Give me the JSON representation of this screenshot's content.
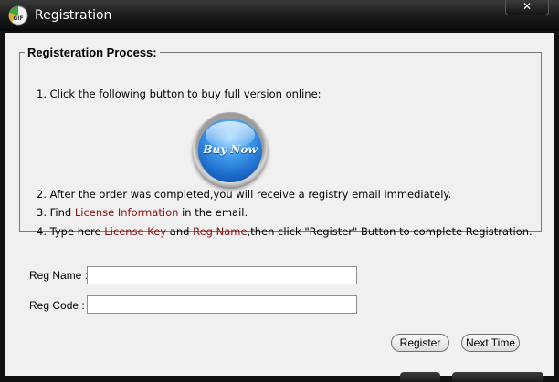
{
  "window": {
    "title": "Registration",
    "close_label": "✕",
    "icon": "gif-app-icon"
  },
  "process": {
    "legend": "Registeration Process:",
    "step1": "1. Click the following button to buy full version online:",
    "buy_now_label": "Buy Now",
    "step2": "2. After the order was completed,you will receive a registry email immediately.",
    "step3": {
      "prefix": "3. Find ",
      "highlight": "License Information",
      "suffix": " in the email."
    },
    "step4": {
      "prefix": "4. Type here ",
      "highlight1": "License Key",
      "middle": " and ",
      "highlight2": "Reg Name",
      "suffix": ",then click \"Register\" Button to complete Registration."
    }
  },
  "form": {
    "reg_name_label": "Reg Name :",
    "reg_name_value": "",
    "reg_code_label": "Reg Code :",
    "reg_code_value": ""
  },
  "buttons": {
    "register": "Register",
    "next_time": "Next Time"
  },
  "colors": {
    "highlight": "#8b1010",
    "titlebar": "#1e1e1e",
    "client_bg": "#f0f0f0"
  }
}
